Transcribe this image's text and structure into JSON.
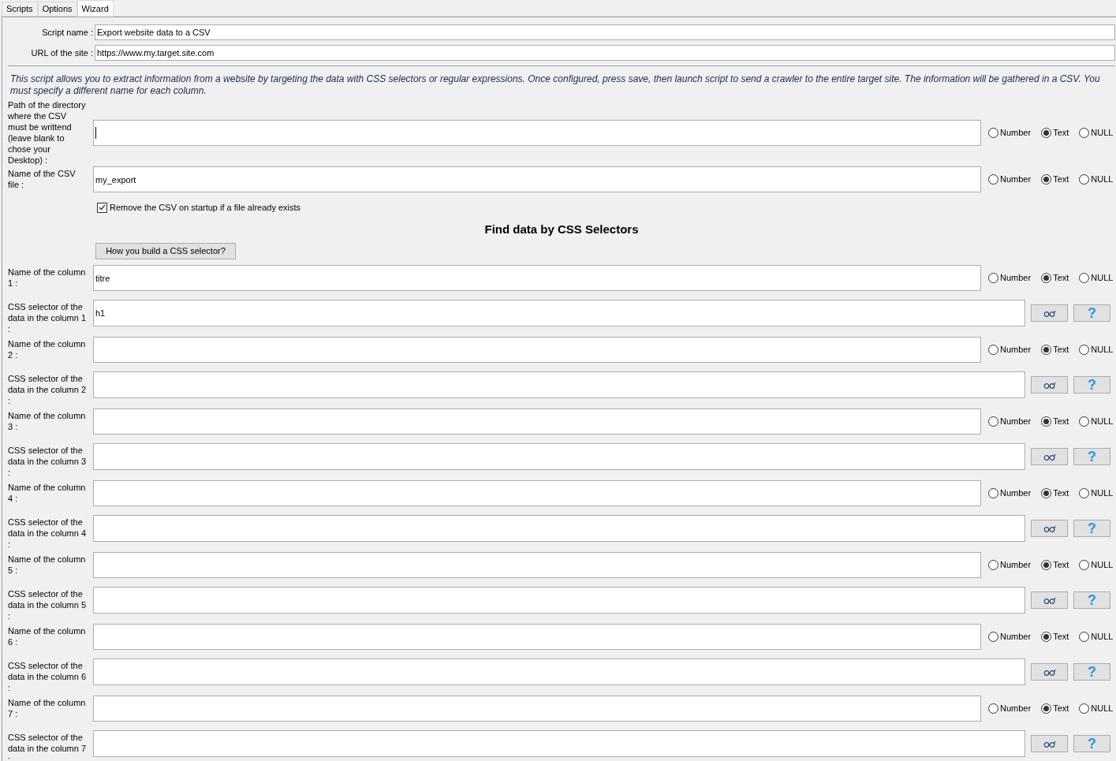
{
  "tabs": [
    {
      "label": "Scripts",
      "selected": false
    },
    {
      "label": "Options",
      "selected": false
    },
    {
      "label": "Wizard",
      "selected": true
    }
  ],
  "header_fields": [
    {
      "label": "Script name :",
      "value": "Export website data to a CSV"
    },
    {
      "label": "URL of the site :",
      "value": "https://www.my.target.site.com"
    }
  ],
  "description": "This script allows you to extract information from a website by targeting the data with CSS selectors or regular expressions. Once configured, press save, then launch script to send a crawler to the entire target site. The information will be gathered in a CSV. You must specify a different name for each column.",
  "form_rows": [
    {
      "kind": "field",
      "label": "Path of the directory where the CSV must be writtend (leave blank to chose your Desktop) :",
      "value": "",
      "focused": true,
      "types": [
        {
          "label": "Number",
          "selected": false
        },
        {
          "label": "Text",
          "selected": true
        },
        {
          "label": "NULL",
          "selected": false
        }
      ]
    },
    {
      "kind": "field",
      "label": "Name of the CSV file :",
      "value": "my_export",
      "types": [
        {
          "label": "Number",
          "selected": false
        },
        {
          "label": "Text",
          "selected": true
        },
        {
          "label": "NULL",
          "selected": false
        }
      ]
    },
    {
      "kind": "checkbox",
      "label": "Remove the CSV on startup if a file already exists",
      "checked": true
    },
    {
      "kind": "heading",
      "label": "Find data by CSS Selectors"
    },
    {
      "kind": "button",
      "label": "How you build a CSS selector?"
    },
    {
      "kind": "field",
      "label": "Name of the column 1 :",
      "value": "titre",
      "types": [
        {
          "label": "Number",
          "selected": false
        },
        {
          "label": "Text",
          "selected": true
        },
        {
          "label": "NULL",
          "selected": false
        }
      ]
    },
    {
      "kind": "selector",
      "label": "CSS selector of the data in the column 1 :",
      "value": "h1",
      "help": "?"
    },
    {
      "kind": "field",
      "label": "Name of the column 2 :",
      "value": "",
      "types": [
        {
          "label": "Number",
          "selected": false
        },
        {
          "label": "Text",
          "selected": true
        },
        {
          "label": "NULL",
          "selected": false
        }
      ]
    },
    {
      "kind": "selector",
      "label": "CSS selector of the data in the column 2 :",
      "value": "",
      "help": "?"
    },
    {
      "kind": "field",
      "label": "Name of the column 3 :",
      "value": "",
      "types": [
        {
          "label": "Number",
          "selected": false
        },
        {
          "label": "Text",
          "selected": true
        },
        {
          "label": "NULL",
          "selected": false
        }
      ]
    },
    {
      "kind": "selector",
      "label": "CSS selector of the data in the column 3 :",
      "value": "",
      "help": "?"
    },
    {
      "kind": "field",
      "label": "Name of the column 4 :",
      "value": "",
      "types": [
        {
          "label": "Number",
          "selected": false
        },
        {
          "label": "Text",
          "selected": true
        },
        {
          "label": "NULL",
          "selected": false
        }
      ]
    },
    {
      "kind": "selector",
      "label": "CSS selector of the data in the column 4 :",
      "value": "",
      "help": "?"
    },
    {
      "kind": "field",
      "label": "Name of the column 5 :",
      "value": "",
      "types": [
        {
          "label": "Number",
          "selected": false
        },
        {
          "label": "Text",
          "selected": true
        },
        {
          "label": "NULL",
          "selected": false
        }
      ]
    },
    {
      "kind": "selector",
      "label": "CSS selector of the data in the column 5 :",
      "value": "",
      "help": "?"
    },
    {
      "kind": "field",
      "label": "Name of the column 6 :",
      "value": "",
      "types": [
        {
          "label": "Number",
          "selected": false
        },
        {
          "label": "Text",
          "selected": true
        },
        {
          "label": "NULL",
          "selected": false
        }
      ]
    },
    {
      "kind": "selector",
      "label": "CSS selector of the data in the column 6 :",
      "value": "",
      "help": "?"
    },
    {
      "kind": "field",
      "label": "Name of the column 7 :",
      "value": "",
      "types": [
        {
          "label": "Number",
          "selected": false
        },
        {
          "label": "Text",
          "selected": true
        },
        {
          "label": "NULL",
          "selected": false
        }
      ]
    },
    {
      "kind": "selector",
      "label": "CSS selector of the data in the column 7 :",
      "value": "",
      "help": "?"
    }
  ]
}
